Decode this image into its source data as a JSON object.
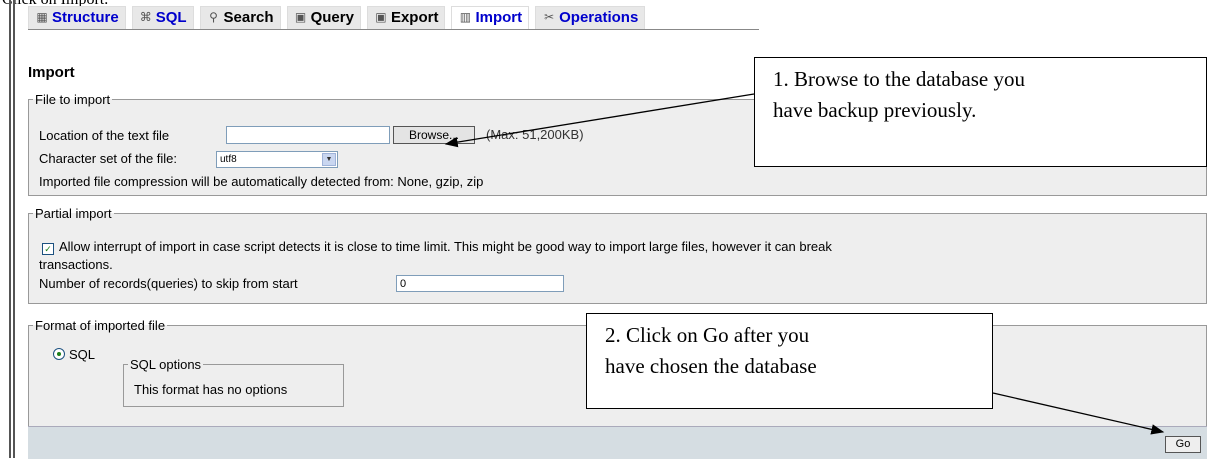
{
  "document": {
    "partial_text": "Click on Import."
  },
  "tabs": [
    {
      "label": "Structure",
      "icon": "structure-icon"
    },
    {
      "label": "SQL",
      "icon": "sql-icon"
    },
    {
      "label": "Search",
      "icon": "search-icon"
    },
    {
      "label": "Query",
      "icon": "query-icon"
    },
    {
      "label": "Export",
      "icon": "export-icon"
    },
    {
      "label": "Import",
      "icon": "import-icon",
      "active": true
    },
    {
      "label": "Operations",
      "icon": "operations-icon"
    }
  ],
  "page": {
    "title": "Import"
  },
  "file_to_import": {
    "legend": "File to import",
    "location_label": "Location of the text file",
    "location_value": "",
    "browse_label": "Browse...",
    "max_size": "(Max: 51,200KB)",
    "charset_label": "Character set of the file:",
    "charset_value": "utf8",
    "compression_note": "Imported file compression will be automatically detected from: None, gzip, zip"
  },
  "partial_import": {
    "legend": "Partial import",
    "allow_interrupt_label": "Allow interrupt of import in case script detects it is close to time limit. This might be good way to import large files, however it can break",
    "allow_interrupt_label_cont": "transactions.",
    "allow_interrupt_checked": true,
    "skip_label": "Number of records(queries) to skip from start",
    "skip_value": "0"
  },
  "format": {
    "legend": "Format of imported file",
    "option_label": "SQL",
    "option_selected": true,
    "options_legend": "SQL options",
    "options_text": "This format has no options"
  },
  "go_button": {
    "label": "Go"
  },
  "callouts": {
    "browse": [
      "1. Browse to the database you",
      "have backup previously."
    ],
    "go": [
      "2. Click on Go after you",
      "have chosen the database"
    ]
  }
}
